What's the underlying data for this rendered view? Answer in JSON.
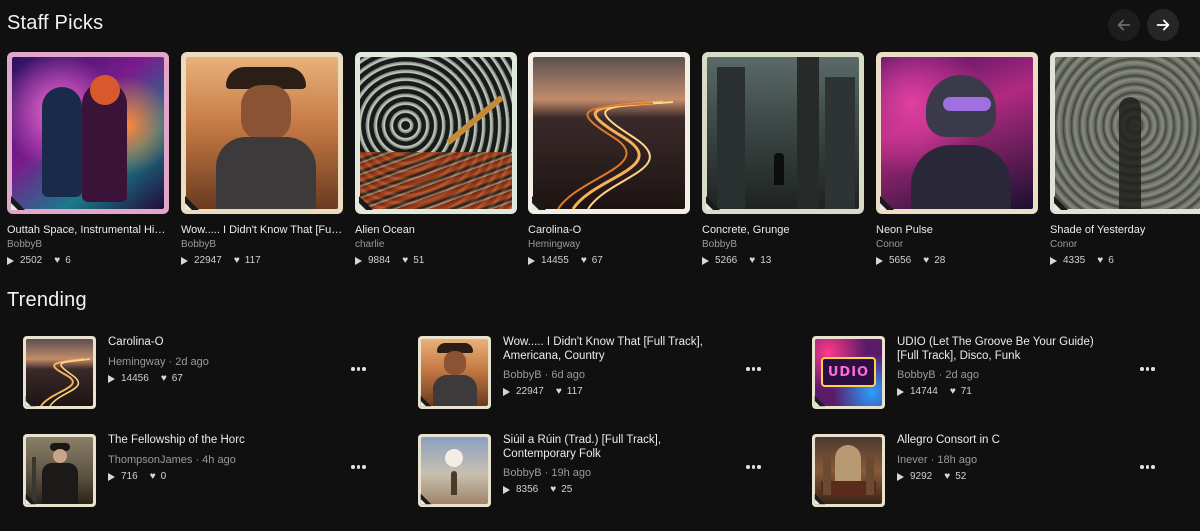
{
  "staff_picks": {
    "title": "Staff Picks",
    "items": [
      {
        "title": "Outtah Space, Instrumental Hip...",
        "author": "BobbyB",
        "plays": "2502",
        "likes": "6",
        "frame": "#e2a6c9"
      },
      {
        "title": "Wow..... I Didn't Know That [Full...",
        "author": "BobbyB",
        "plays": "22947",
        "likes": "117",
        "frame": "#ecdcbf"
      },
      {
        "title": "Alien Ocean",
        "author": "charlie",
        "plays": "9884",
        "likes": "51",
        "frame": "#dfe9dc"
      },
      {
        "title": "Carolina-O",
        "author": "Hemingway",
        "plays": "14455",
        "likes": "67",
        "frame": "#f3efe7"
      },
      {
        "title": "Concrete, Grunge",
        "author": "BobbyB",
        "plays": "5266",
        "likes": "13",
        "frame": "#d8dcc6"
      },
      {
        "title": "Neon Pulse",
        "author": "Conor",
        "plays": "5656",
        "likes": "28",
        "frame": "#ecdfc6"
      },
      {
        "title": "Shade of Yesterday",
        "author": "Conor",
        "plays": "4335",
        "likes": "6",
        "frame": "#dfe3d8"
      }
    ]
  },
  "trending": {
    "title": "Trending",
    "items": [
      {
        "title": "Carolina-O",
        "author": "Hemingway",
        "age": "2d ago",
        "plays": "14456",
        "likes": "67"
      },
      {
        "title": "Wow..... I Didn't Know That [Full Track], Americana, Country",
        "author": "BobbyB",
        "age": "6d ago",
        "plays": "22947",
        "likes": "117"
      },
      {
        "title": "UDIO (Let The Groove Be Your Guide) [Full Track], Disco, Funk",
        "author": "BobbyB",
        "age": "2d ago",
        "plays": "14744",
        "likes": "71"
      },
      {
        "title": "The Fellowship of the Horc",
        "author": "ThompsonJames",
        "age": "4h ago",
        "plays": "716",
        "likes": "0"
      },
      {
        "title": "Siúil a Rúin (Trad.) [Full Track], Contemporary Folk",
        "author": "BobbyB",
        "age": "19h ago",
        "plays": "8356",
        "likes": "25"
      },
      {
        "title": "Allegro Consort in C",
        "author": "Inever",
        "age": "18h ago",
        "plays": "9292",
        "likes": "52"
      }
    ]
  },
  "icons": {
    "prev": "arrow-left-icon",
    "next": "arrow-right-icon",
    "play": "play-icon",
    "like": "heart-icon",
    "more": "more-horizontal-icon",
    "corner": "udio-logo-icon"
  },
  "separator": "·",
  "udio_badge": "UDIO"
}
